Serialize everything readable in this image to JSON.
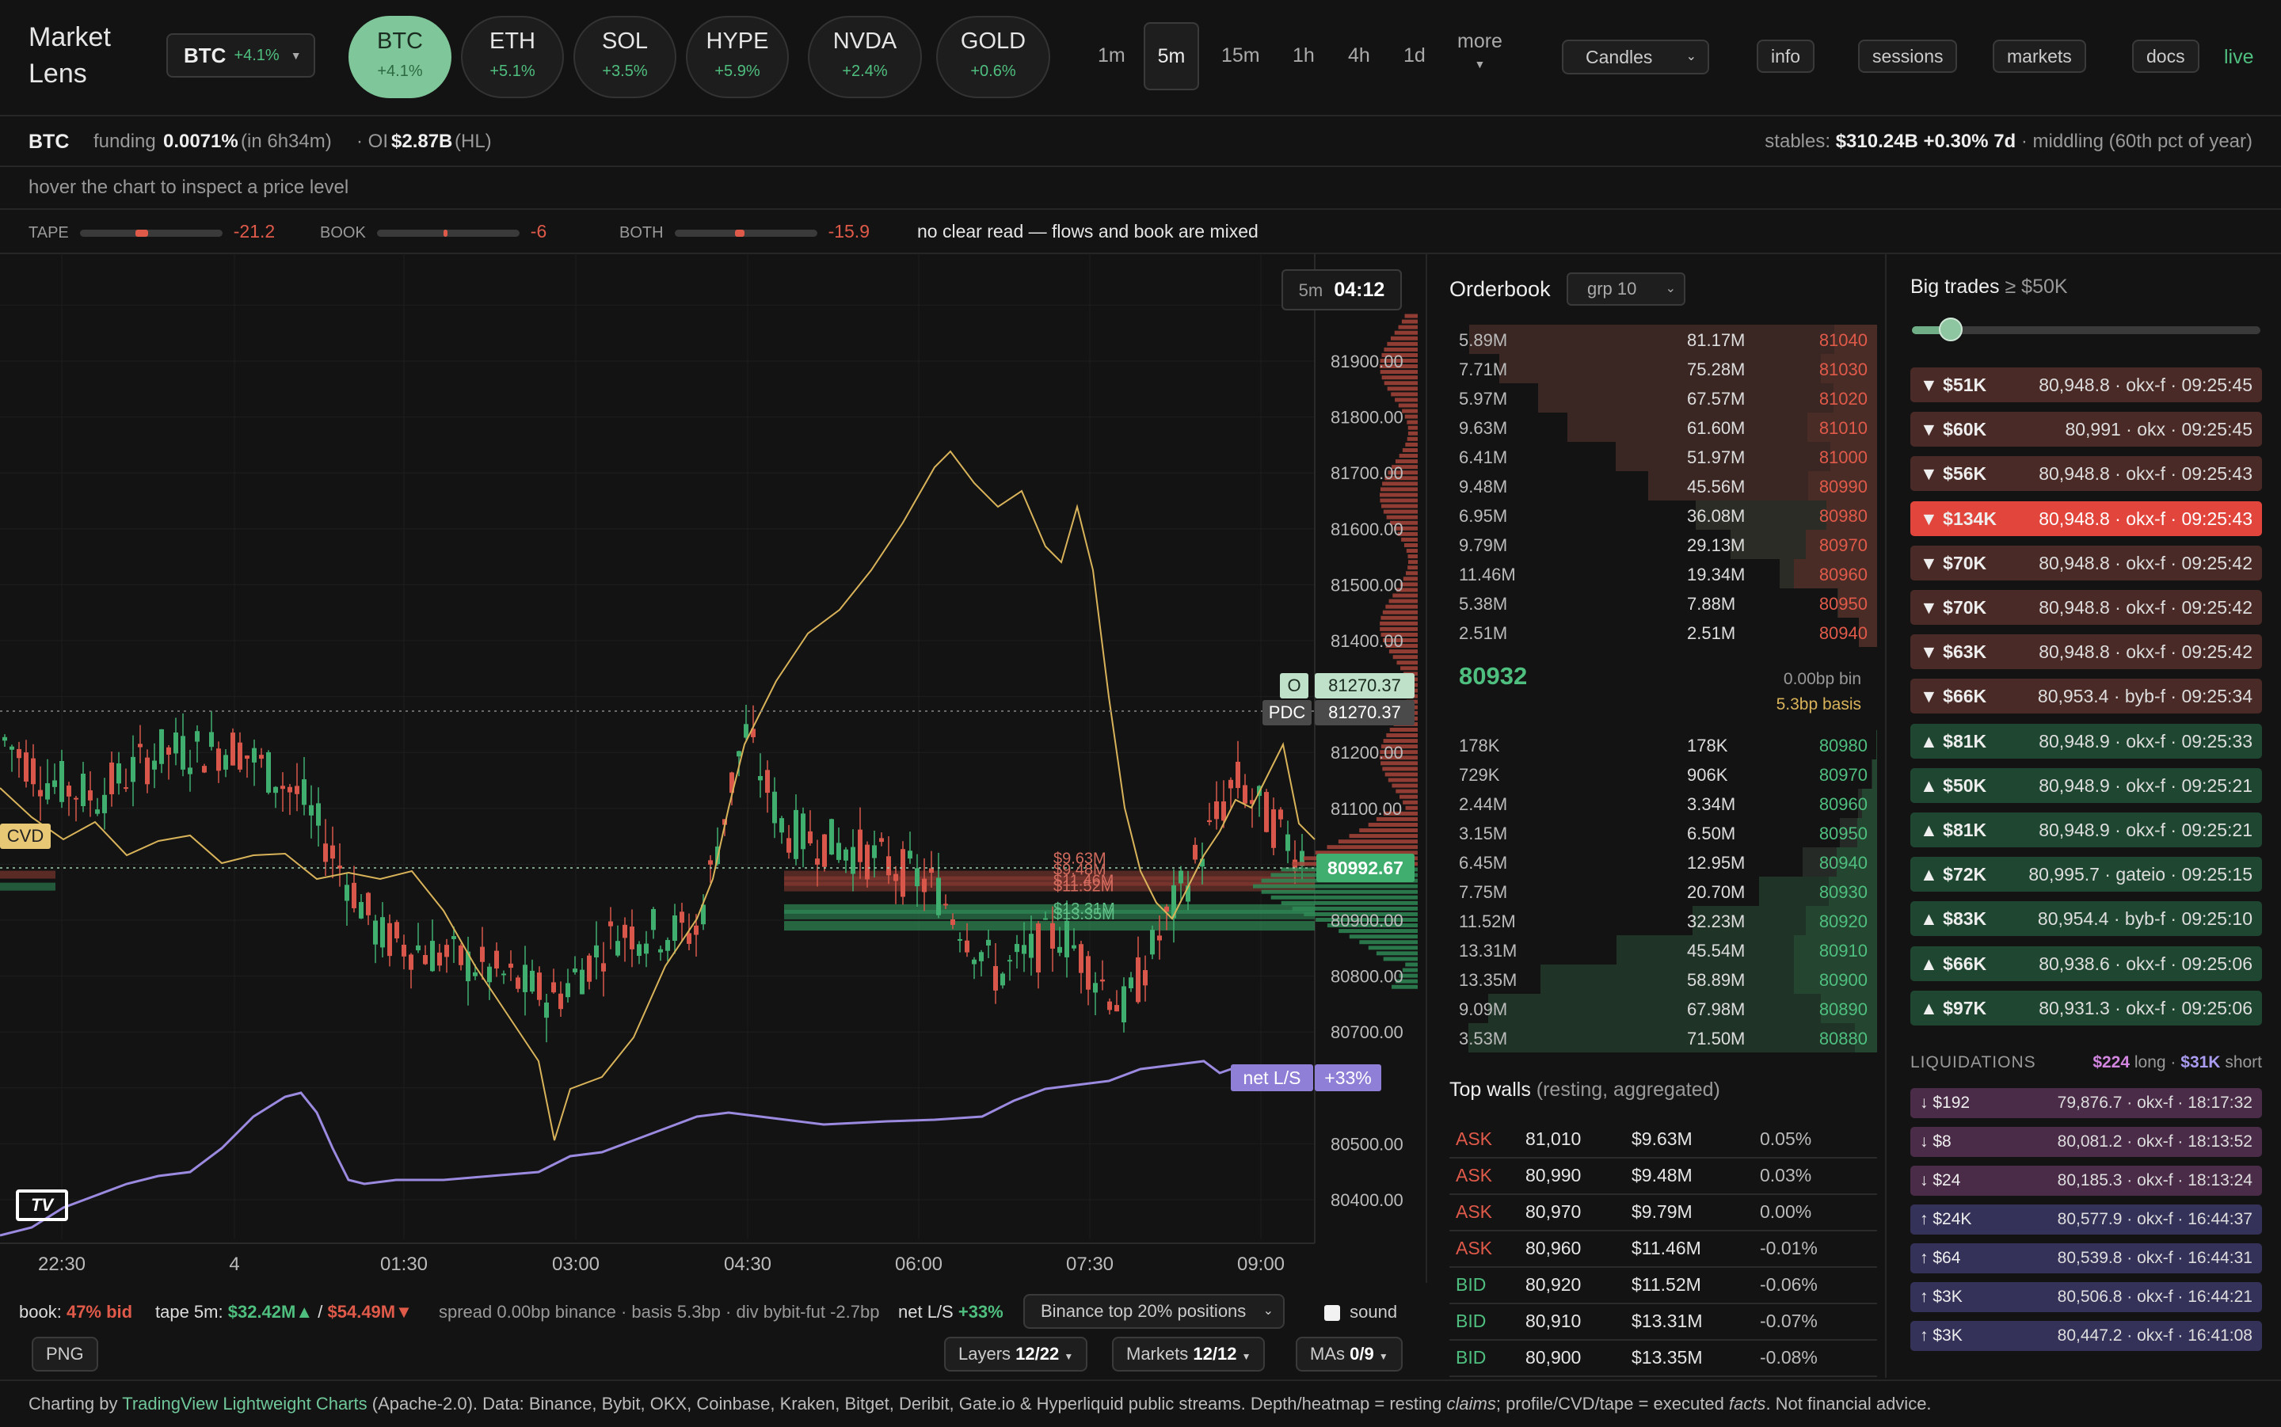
{
  "app": {
    "title_line1": "Market",
    "title_line2": "Lens"
  },
  "symbol_select": {
    "symbol": "BTC",
    "change": "+4.1%"
  },
  "assets": [
    {
      "name": "BTC",
      "change": "+4.1%"
    },
    {
      "name": "ETH",
      "change": "+5.1%"
    },
    {
      "name": "SOL",
      "change": "+3.5%"
    },
    {
      "name": "HYPE",
      "change": "+5.9%"
    },
    {
      "name": "NVDA",
      "change": "+2.4%"
    },
    {
      "name": "GOLD",
      "change": "+0.6%"
    }
  ],
  "timeframes": [
    "1m",
    "5m",
    "15m",
    "1h",
    "4h",
    "1d"
  ],
  "active_timeframe": "5m",
  "more_label": "more",
  "chart_type": "Candles",
  "nav": {
    "info": "info",
    "sessions": "sessions",
    "markets": "markets",
    "docs": "docs",
    "live": "live"
  },
  "info_row": {
    "symbol": "BTC",
    "funding_label": "funding",
    "funding_value": "0.0071%",
    "funding_time": "(in 6h34m)",
    "oi_label": "· OI",
    "oi_value": "$2.87B",
    "oi_source": "(HL)",
    "stables_label": "stables:",
    "stables_value": "$310.24B",
    "stables_change": "+0.30% 7d",
    "stables_note": "· middling (60th pct of year)"
  },
  "hint": "hover the chart to inspect a price level",
  "signals": {
    "tape_label": "TAPE",
    "tape_value": "-21.2",
    "book_label": "BOOK",
    "book_value": "-6",
    "both_label": "BOTH",
    "both_value": "-15.9",
    "read": "no clear read — flows and book are mixed"
  },
  "chart": {
    "countdown_tf": "5m",
    "countdown": "04:12",
    "price_labels": [
      "81900.00",
      "81800.00",
      "81700.00",
      "81600.00",
      "81500.00",
      "81400.00",
      "81200.00",
      "81100.00",
      "80900.00",
      "80800.00",
      "80700.00",
      "80500.00",
      "80400.00"
    ],
    "time_labels": [
      "22:30",
      "4",
      "01:30",
      "03:00",
      "04:30",
      "06:00",
      "07:30",
      "09:00"
    ],
    "open_tag": "O",
    "open_value": "81270.37",
    "pdc_tag": "PDC",
    "pdc_value": "81270.37",
    "last_price": "80992.67",
    "cvd_tag": "CVD",
    "netls_tag": "net L/S",
    "netls_value": "+33%",
    "wall_labels": [
      "$9.63M",
      "$9.48M",
      "$11.46M",
      "$11.52M",
      "$13.31M",
      "$13.35M"
    ],
    "logo": "TV"
  },
  "orderbook": {
    "title": "Orderbook",
    "group": "grp 10",
    "asks": [
      {
        "size": "5.89M",
        "total": "81.17M",
        "price": "81040"
      },
      {
        "size": "7.71M",
        "total": "75.28M",
        "price": "81030"
      },
      {
        "size": "5.97M",
        "total": "67.57M",
        "price": "81020"
      },
      {
        "size": "9.63M",
        "total": "61.60M",
        "price": "81010"
      },
      {
        "size": "6.41M",
        "total": "51.97M",
        "price": "81000"
      },
      {
        "size": "9.48M",
        "total": "45.56M",
        "price": "80990"
      },
      {
        "size": "6.95M",
        "total": "36.08M",
        "price": "80980"
      },
      {
        "size": "9.79M",
        "total": "29.13M",
        "price": "80970"
      },
      {
        "size": "11.46M",
        "total": "19.34M",
        "price": "80960"
      },
      {
        "size": "5.38M",
        "total": "7.88M",
        "price": "80950"
      },
      {
        "size": "2.51M",
        "total": "2.51M",
        "price": "80940"
      }
    ],
    "mid": "80932",
    "bin": "0.00bp bin",
    "basis": "5.3bp basis",
    "bids": [
      {
        "size": "178K",
        "total": "178K",
        "price": "80980"
      },
      {
        "size": "729K",
        "total": "906K",
        "price": "80970"
      },
      {
        "size": "2.44M",
        "total": "3.34M",
        "price": "80960"
      },
      {
        "size": "3.15M",
        "total": "6.50M",
        "price": "80950"
      },
      {
        "size": "6.45M",
        "total": "12.95M",
        "price": "80940"
      },
      {
        "size": "7.75M",
        "total": "20.70M",
        "price": "80930"
      },
      {
        "size": "11.52M",
        "total": "32.23M",
        "price": "80920"
      },
      {
        "size": "13.31M",
        "total": "45.54M",
        "price": "80910"
      },
      {
        "size": "13.35M",
        "total": "58.89M",
        "price": "80900"
      },
      {
        "size": "9.09M",
        "total": "67.98M",
        "price": "80890"
      },
      {
        "size": "3.53M",
        "total": "71.50M",
        "price": "80880"
      }
    ],
    "walls_title": "Top walls",
    "walls_sub": "(resting, aggregated)",
    "walls": [
      {
        "side": "ASK",
        "price": "81,010",
        "size": "$9.63M",
        "dist": "0.05%"
      },
      {
        "side": "ASK",
        "price": "80,990",
        "size": "$9.48M",
        "dist": "0.03%"
      },
      {
        "side": "ASK",
        "price": "80,970",
        "size": "$9.79M",
        "dist": "0.00%"
      },
      {
        "side": "ASK",
        "price": "80,960",
        "size": "$11.46M",
        "dist": "-0.01%"
      },
      {
        "side": "BID",
        "price": "80,920",
        "size": "$11.52M",
        "dist": "-0.06%"
      },
      {
        "side": "BID",
        "price": "80,910",
        "size": "$13.31M",
        "dist": "-0.07%"
      },
      {
        "side": "BID",
        "price": "80,900",
        "size": "$13.35M",
        "dist": "-0.08%"
      }
    ]
  },
  "big_trades": {
    "title": "Big trades",
    "threshold": "≥ $50K",
    "slider_value": 0.1,
    "trades": [
      {
        "dir": "sell",
        "label": "▼ $51K",
        "detail": "80,948.8 · okx-f · 09:25:45"
      },
      {
        "dir": "sell",
        "label": "▼ $60K",
        "detail": "80,991 · okx · 09:25:45"
      },
      {
        "dir": "sell",
        "label": "▼ $56K",
        "detail": "80,948.8 · okx-f · 09:25:43"
      },
      {
        "dir": "sell-big",
        "label": "▼ $134K",
        "detail": "80,948.8 · okx-f · 09:25:43"
      },
      {
        "dir": "sell",
        "label": "▼ $70K",
        "detail": "80,948.8 · okx-f · 09:25:42"
      },
      {
        "dir": "sell",
        "label": "▼ $70K",
        "detail": "80,948.8 · okx-f · 09:25:42"
      },
      {
        "dir": "sell",
        "label": "▼ $63K",
        "detail": "80,948.8 · okx-f · 09:25:42"
      },
      {
        "dir": "sell",
        "label": "▼ $66K",
        "detail": "80,953.4 · byb-f · 09:25:34"
      },
      {
        "dir": "buy",
        "label": "▲ $81K",
        "detail": "80,948.9 · okx-f · 09:25:33"
      },
      {
        "dir": "buy",
        "label": "▲ $50K",
        "detail": "80,948.9 · okx-f · 09:25:21"
      },
      {
        "dir": "buy",
        "label": "▲ $81K",
        "detail": "80,948.9 · okx-f · 09:25:21"
      },
      {
        "dir": "buy",
        "label": "▲ $72K",
        "detail": "80,995.7 · gateio · 09:25:15"
      },
      {
        "dir": "buy",
        "label": "▲ $83K",
        "detail": "80,954.4 · byb-f · 09:25:10"
      },
      {
        "dir": "buy",
        "label": "▲ $66K",
        "detail": "80,938.6 · okx-f · 09:25:06"
      },
      {
        "dir": "buy",
        "label": "▲ $97K",
        "detail": "80,931.3 · okx-f · 09:25:06"
      }
    ],
    "liq_title": "LIQUIDATIONS",
    "liq_long": "$224",
    "liq_long_label": "long ·",
    "liq_short": "$31K",
    "liq_short_label": "short",
    "liquidations": [
      {
        "dir": "long",
        "label": "↓ $192",
        "detail": "79,876.7 · okx-f · 18:17:32"
      },
      {
        "dir": "long",
        "label": "↓ $8",
        "detail": "80,081.2 · okx-f · 18:13:52"
      },
      {
        "dir": "long",
        "label": "↓ $24",
        "detail": "80,185.3 · okx-f · 18:13:24"
      },
      {
        "dir": "short",
        "label": "↑ $24K",
        "detail": "80,577.9 · okx-f · 16:44:37"
      },
      {
        "dir": "short",
        "label": "↑ $64",
        "detail": "80,539.8 · okx-f · 16:44:31"
      },
      {
        "dir": "short",
        "label": "↑ $3K",
        "detail": "80,506.8 · okx-f · 16:44:21"
      },
      {
        "dir": "short",
        "label": "↑ $3K",
        "detail": "80,447.2 · okx-f · 16:41:08"
      }
    ]
  },
  "bottom": {
    "book_label": "book:",
    "book_value": "47% bid",
    "tape_label": "tape 5m:",
    "tape_buy": "$32.42M▲",
    "tape_sep": "/",
    "tape_sell": "$54.49M▼",
    "spread": "spread 0.00bp binance · basis 5.3bp · div bybit-fut -2.7bp",
    "netls_label": "net L/S",
    "netls_value": "+33%",
    "positions_select": "Binance top 20% positions",
    "sound_label": "sound",
    "png_label": "PNG",
    "layers_label": "Layers",
    "layers_value": "12/22",
    "markets_label": "Markets",
    "markets_value": "12/12",
    "mas_label": "MAs",
    "mas_value": "0/9"
  },
  "footer": {
    "prefix": "Charting by",
    "link": "TradingView Lightweight Charts",
    "rest1": "(Apache-2.0). Data: Binance, Bybit, OKX, Coinbase, Kraken, Bitget, Deribit, Gate.io & Hyperliquid public streams. Depth/heatmap = resting",
    "claims": "claims",
    "rest2": "; profile/CVD/tape = executed",
    "facts": "facts",
    "rest3": ". Not financial advice."
  },
  "colors": {
    "up": "#3fae6f",
    "down": "#d8574a",
    "cvd": "#d9b35a",
    "netls": "#9b8ae0"
  }
}
